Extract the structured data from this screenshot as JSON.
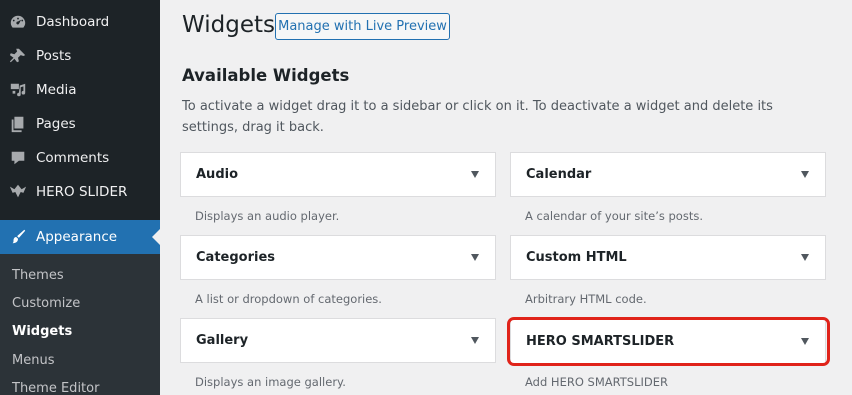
{
  "sidebar": {
    "items": [
      {
        "label": "Dashboard",
        "icon": "dashboard-icon"
      },
      {
        "label": "Posts",
        "icon": "pin-icon"
      },
      {
        "label": "Media",
        "icon": "media-icon"
      },
      {
        "label": "Pages",
        "icon": "pages-icon"
      },
      {
        "label": "Comments",
        "icon": "comment-icon"
      },
      {
        "label": "HERO SLIDER",
        "icon": "hero-slider-icon"
      },
      {
        "label": "Appearance",
        "icon": "brush-icon"
      }
    ],
    "submenu": [
      "Themes",
      "Customize",
      "Widgets",
      "Menus",
      "Theme Editor"
    ],
    "active_color": "#2271b1"
  },
  "header": {
    "title": "Widgets",
    "live_preview_label": "Manage with Live Preview"
  },
  "available": {
    "title": "Available Widgets",
    "description": "To activate a widget drag it to a sidebar or click on it. To deactivate a widget and delete its settings, drag it back."
  },
  "widgets": [
    {
      "title": "Audio",
      "desc": "Displays an audio player."
    },
    {
      "title": "Calendar",
      "desc": "A calendar of your site’s posts."
    },
    {
      "title": "Categories",
      "desc": "A list or dropdown of categories."
    },
    {
      "title": "Custom HTML",
      "desc": "Arbitrary HTML code."
    },
    {
      "title": "Gallery",
      "desc": "Displays an image gallery."
    },
    {
      "title": "HERO SMARTSLIDER",
      "desc": "Add HERO SMARTSLIDER"
    }
  ],
  "highlight_color": "#e0231a"
}
